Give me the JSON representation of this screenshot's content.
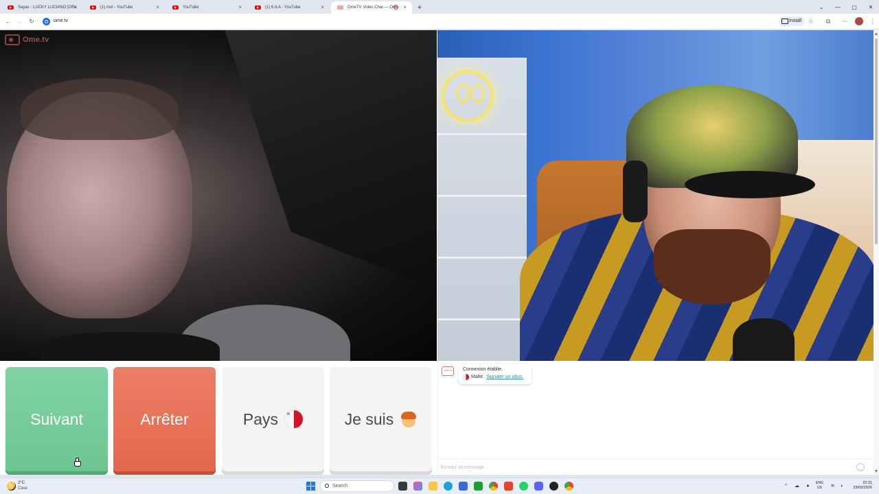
{
  "browser": {
    "tabs": [
      {
        "title": "Sayax - LUCKY LUCIANO [Offic",
        "active": false
      },
      {
        "title": "(1) mol - YouTube",
        "active": false
      },
      {
        "title": "YouTube",
        "active": false
      },
      {
        "title": "(1) 6.ILA - YouTube",
        "active": false
      },
      {
        "title": "OmeTV Video Chat — Ome",
        "active": true
      }
    ],
    "new_tab_symbol": "+",
    "url": "ome.tv",
    "install_label": "Install",
    "window_controls": [
      "⌄",
      "—",
      "▢",
      "✕"
    ]
  },
  "app": {
    "brand_name": "Ome.tv",
    "buttons": {
      "next": "Suivant",
      "stop": "Arrêter",
      "country": "Pays",
      "iam": "Je suis"
    },
    "chat": {
      "logo_text": "Ome.tv",
      "system_message": "Connexion établie.",
      "partner_country": "Malte.",
      "report_link": "Signaler un abus.",
      "input_placeholder": "Écrivez un message"
    }
  },
  "taskbar": {
    "temperature": "2°C",
    "condition": "Clear",
    "search_label": "Search",
    "language_line1": "ENG",
    "language_line2": "US",
    "time": "22:31",
    "date": "23/03/2026"
  },
  "colors": {
    "next_button": "#6cc692",
    "stop_button": "#e4674c",
    "neutral_button": "#f4f4f4",
    "link": "#2e8ca9",
    "brand": "#d06a6a"
  },
  "icons": {
    "country_flag": "malta-flag-icon",
    "iam_emoji": "boy-emoji-icon",
    "emoji_button": "smiley-icon"
  }
}
